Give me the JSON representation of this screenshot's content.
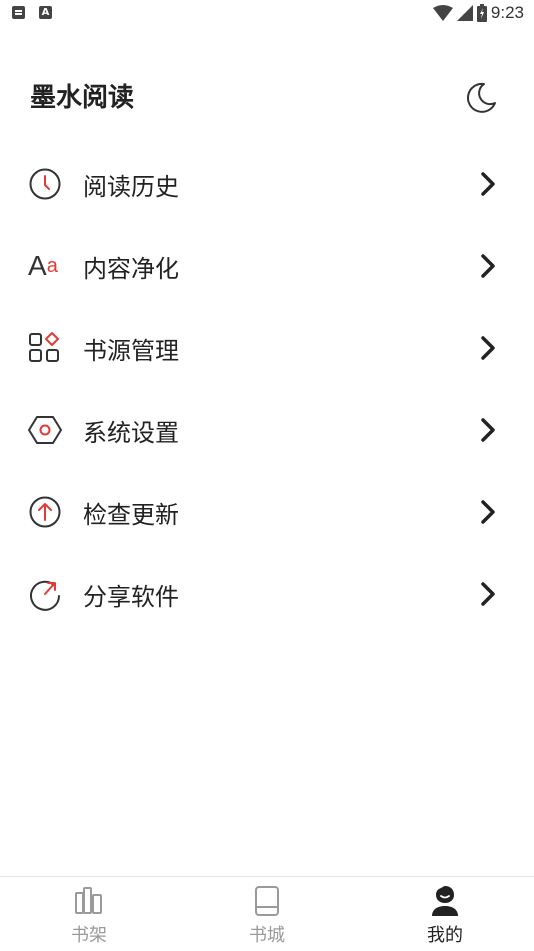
{
  "status_bar": {
    "time": "9:23",
    "notif_letter": "A"
  },
  "header": {
    "title": "墨水阅读",
    "theme_icon": "moon-icon"
  },
  "menu": [
    {
      "label": "阅读历史",
      "icon": "clock-icon"
    },
    {
      "label": "内容净化",
      "icon": "font-aa-icon",
      "icon_text_a": "A",
      "icon_text_b": "a"
    },
    {
      "label": "书源管理",
      "icon": "apps-grid-icon"
    },
    {
      "label": "系统设置",
      "icon": "settings-hexagon-icon"
    },
    {
      "label": "检查更新",
      "icon": "arrow-up-circle-icon"
    },
    {
      "label": "分享软件",
      "icon": "share-refresh-icon"
    }
  ],
  "bottom_nav": [
    {
      "label": "书架",
      "icon": "bookshelf-icon",
      "active": false
    },
    {
      "label": "书城",
      "icon": "book-icon",
      "active": false
    },
    {
      "label": "我的",
      "icon": "user-icon",
      "active": true
    }
  ],
  "colors": {
    "accent": "#e53935",
    "text": "#222222",
    "inactive": "#9a9a9a"
  }
}
